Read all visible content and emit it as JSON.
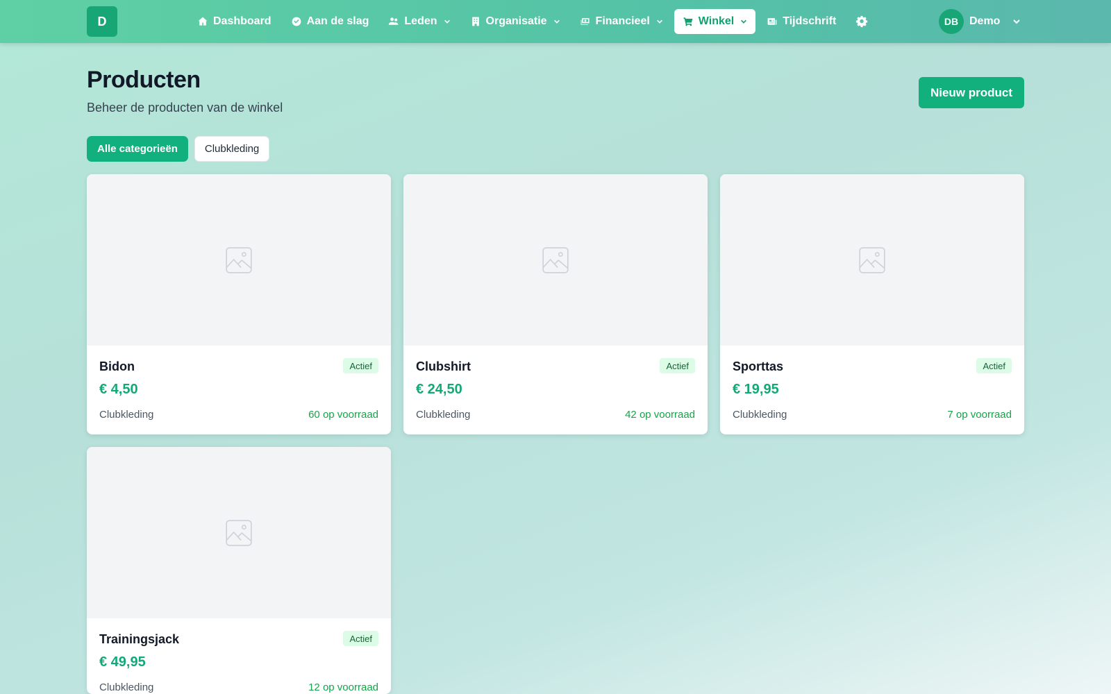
{
  "app": {
    "logo_letter": "D"
  },
  "nav": {
    "items": [
      {
        "label": "Dashboard",
        "icon": "home-icon"
      },
      {
        "label": "Aan de slag",
        "icon": "check-circle-icon"
      },
      {
        "label": "Leden",
        "icon": "users-icon",
        "dropdown": true
      },
      {
        "label": "Organisatie",
        "icon": "building-icon",
        "dropdown": true
      },
      {
        "label": "Financieel",
        "icon": "money-icon",
        "dropdown": true
      },
      {
        "label": "Winkel",
        "icon": "cart-icon",
        "dropdown": true,
        "active": true
      },
      {
        "label": "Tijdschrift",
        "icon": "newspaper-icon"
      }
    ],
    "settings_icon": "gear-icon"
  },
  "user": {
    "initials": "DB",
    "name": "Demo"
  },
  "header": {
    "title": "Producten",
    "subtitle": "Beheer de producten van de winkel",
    "new_button": "Nieuw product"
  },
  "filters": [
    {
      "label": "Alle categorieën",
      "active": true
    },
    {
      "label": "Clubkleding",
      "active": false
    }
  ],
  "products": [
    {
      "name": "Bidon",
      "status": "Actief",
      "price": "€ 4,50",
      "category": "Clubkleding",
      "stock": "60 op voorraad"
    },
    {
      "name": "Clubshirt",
      "status": "Actief",
      "price": "€ 24,50",
      "category": "Clubkleding",
      "stock": "42 op voorraad"
    },
    {
      "name": "Sporttas",
      "status": "Actief",
      "price": "€ 19,95",
      "category": "Clubkleding",
      "stock": "7 op voorraad"
    },
    {
      "name": "Trainingsjack",
      "status": "Actief",
      "price": "€ 49,95",
      "category": "Clubkleding",
      "stock": "12 op voorraad"
    }
  ],
  "colors": {
    "accent": "#12b07d",
    "nav_start": "#5fd0a5",
    "nav_end": "#5bb8ad",
    "badge_bg": "#dcfce7",
    "stock_text": "#16a34a"
  }
}
